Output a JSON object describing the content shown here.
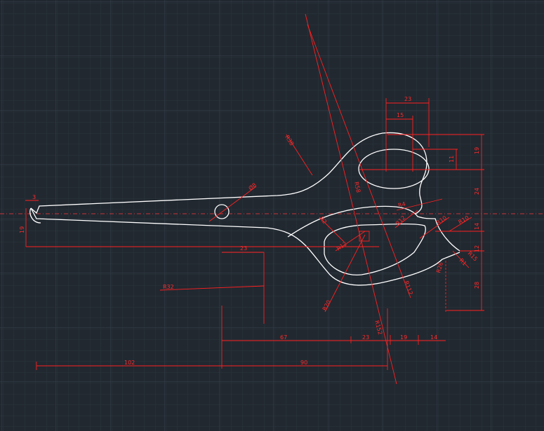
{
  "drawing": {
    "background": "#212830",
    "geometry_color": "#ffffff",
    "dimension_color": "#ff2020",
    "centerline_color": "#ff3030",
    "grid": true
  },
  "dims": {
    "d3": "3",
    "d19_left": "19",
    "d_phi8": "Ø8",
    "d23_mid": "23",
    "r32": "R32",
    "r38": "R38",
    "r58": "R58",
    "r4": "R4",
    "r12_a": "R12",
    "r10_a": "R10",
    "r10_b": "R10",
    "r2": "R2",
    "r12_b": "R12",
    "r20": "R20",
    "r152": "R152",
    "r112": "R112",
    "r26": "R26",
    "r1": "R1",
    "r15": "R15",
    "d23_top": "23",
    "d15_top": "15",
    "d11": "11",
    "d19_right": "19",
    "d24": "24",
    "d14_right": "14",
    "d12": "12",
    "d28": "28",
    "d67": "67",
    "d23_bottom": "23",
    "d19_bottom": "19",
    "d14_bottom": "14",
    "d102": "102",
    "d90": "90"
  }
}
